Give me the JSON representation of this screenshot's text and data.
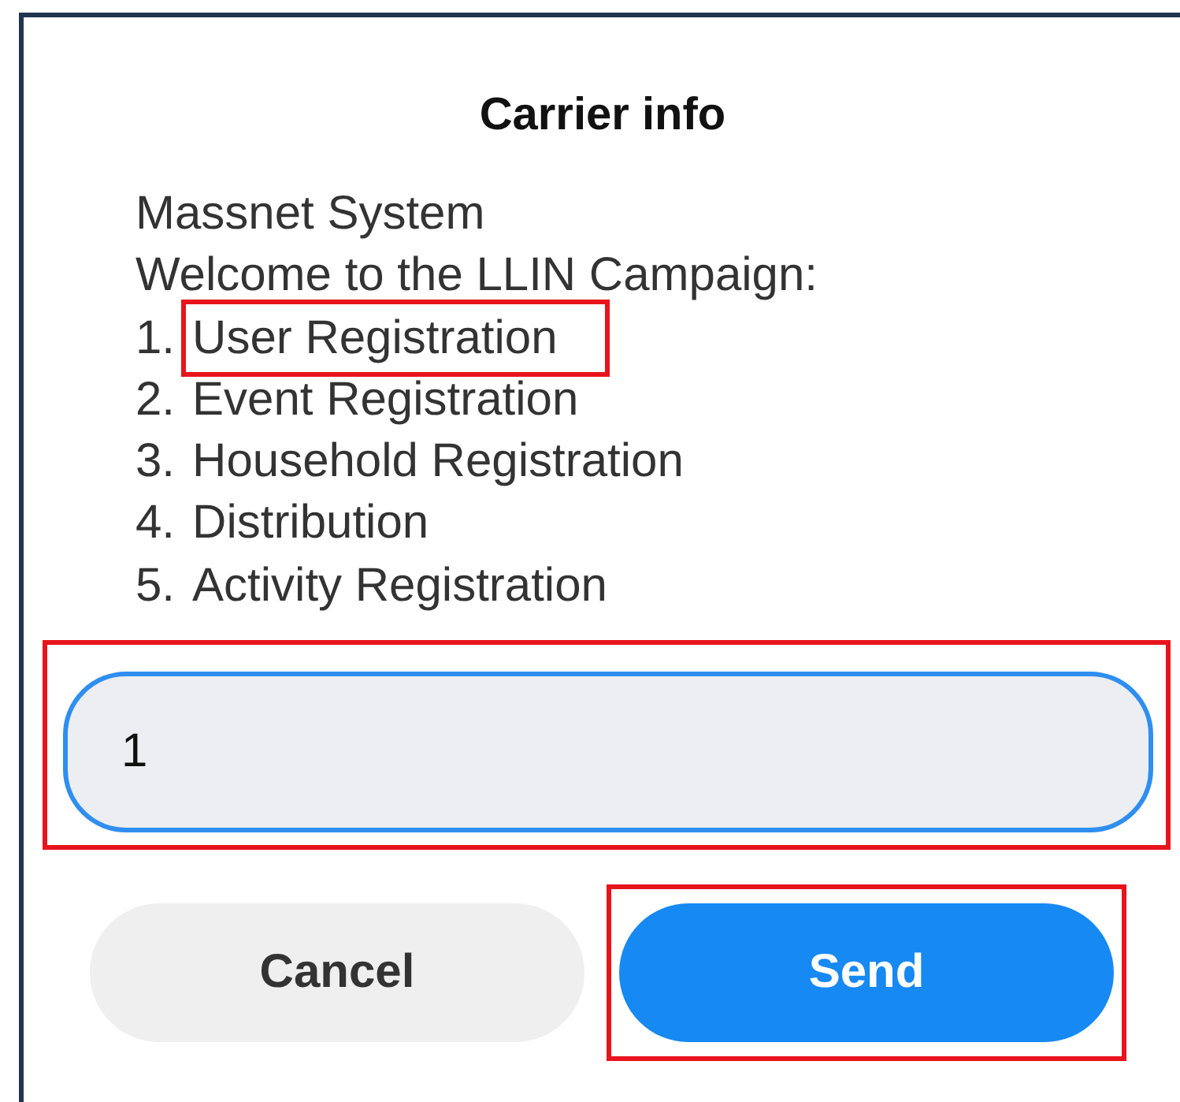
{
  "dialog": {
    "title": "Carrier info",
    "message": [
      "Massnet System",
      "Welcome to the LLIN Campaign:"
    ],
    "options": [
      {
        "number": "1.",
        "label": "User Registration",
        "highlighted": true
      },
      {
        "number": "2.",
        "label": "Event Registration",
        "highlighted": false
      },
      {
        "number": "3.",
        "label": "Household Registration",
        "highlighted": false
      },
      {
        "number": "4.",
        "label": "Distribution",
        "highlighted": false
      },
      {
        "number": "5.",
        "label": "Activity Registration",
        "highlighted": false
      }
    ],
    "input": {
      "value": "1",
      "highlighted": true
    },
    "buttons": [
      {
        "label": "Cancel",
        "kind": "secondary",
        "highlighted": false
      },
      {
        "label": "Send",
        "kind": "primary",
        "highlighted": true
      }
    ]
  }
}
